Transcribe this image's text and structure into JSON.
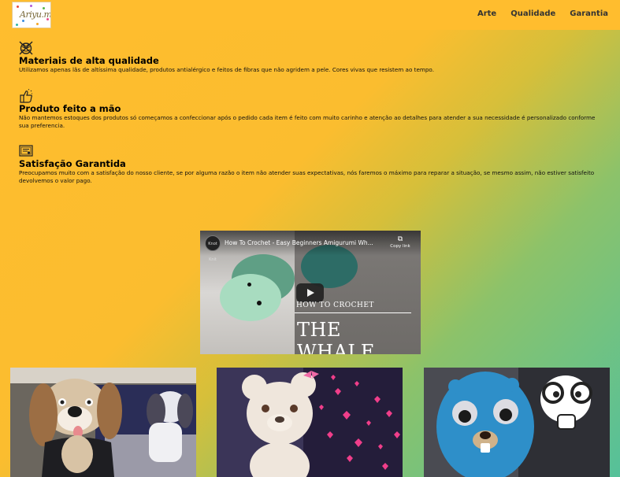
{
  "header": {
    "logo_alt": "Amigurumi logo",
    "logo_text": "Ariyu.me",
    "nav": [
      {
        "label": "Arte"
      },
      {
        "label": "Qualidade"
      },
      {
        "label": "Garantia"
      }
    ]
  },
  "features": [
    {
      "icon": "yarn-needles-icon",
      "title": "Materiais de alta qualidade",
      "text": "Utilizamos apenas lãs de altíssima qualidade, produtos antialérgico e feitos de fibras que não agridem a pele. Cores vivas que resistem ao tempo."
    },
    {
      "icon": "thumbs-up-icon",
      "title": "Produto feito a mão",
      "text": "Não mantemos estoques dos produtos só começamos a confeccionar após o pedido cada item é feito com muito carinho e atenção ao detalhes para atender a sua necessidade é personalizado conforme sua preferencia."
    },
    {
      "icon": "certificate-icon",
      "title": "Satisfação Garantida",
      "text": "Preocupamos muito com a satisfação do nosso cliente, se por alguma razão o item não atender suas expectativas, nós faremos o máximo para reparar a situação, se mesmo assim, não estiver satisfeito devolvemos o valor pago."
    }
  ],
  "video": {
    "title": "How To Crochet - Easy Beginners Amigurumi Wh...",
    "channel": "Knot Knit",
    "copy_link": "Copy link",
    "overlay_small": "HOW TO CROCHET",
    "overlay_big": "THE WHALE"
  },
  "gallery": [
    {
      "alt": "Crochet beagle dog amigurumi next to a photo of a real beagle"
    },
    {
      "alt": "Crochet white teddy bear with pink bow in front of a screen with hearts"
    },
    {
      "alt": "Crochet blue gopher amigurumi in front of a gopher drawing"
    }
  ],
  "colors": {
    "accent": "#ffbd2e",
    "gradient_end": "#55c19a"
  }
}
